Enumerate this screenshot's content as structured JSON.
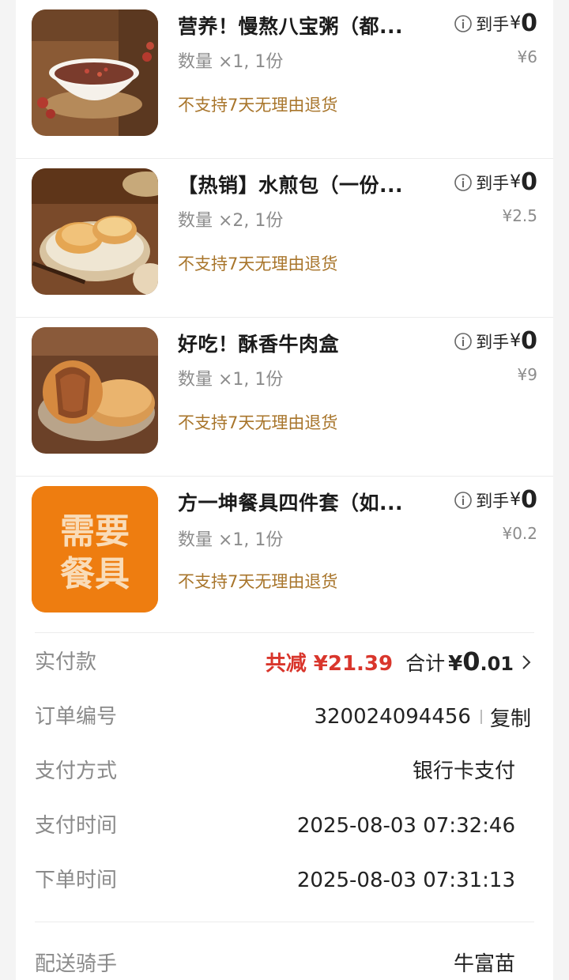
{
  "items": [
    {
      "name": "营养！慢熬八宝粥（都...",
      "qty": "数量 ×1, 1份",
      "policy": "不支持7天无理由退货",
      "net_label": "到手",
      "net_yen": "¥",
      "net_value": "0",
      "original": "¥6",
      "image": "eight-treasure-porridge"
    },
    {
      "name": "【热销】水煎包（一份...",
      "qty": "数量 ×2, 1份",
      "policy": "不支持7天无理由退货",
      "net_label": "到手",
      "net_yen": "¥",
      "net_value": "0",
      "original": "¥2.5",
      "image": "pan-fried-buns"
    },
    {
      "name": "好吃！酥香牛肉盒",
      "qty": "数量 ×1, 1份",
      "policy": "不支持7天无理由退货",
      "net_label": "到手",
      "net_yen": "¥",
      "net_value": "0",
      "original": "¥9",
      "image": "beef-pastry"
    },
    {
      "name": "方一坤餐具四件套（如...",
      "qty": "数量 ×1, 1份",
      "policy": "不支持7天无理由退货",
      "net_label": "到手",
      "net_yen": "¥",
      "net_value": "0",
      "original": "¥0.2",
      "image": "tableware-tile",
      "tile_text": [
        "需要",
        "餐具"
      ],
      "tile_color": "#ee7d10"
    }
  ],
  "payment": {
    "label": "实付款",
    "discount": "共减 ¥21.39",
    "total_label": "合计",
    "total_yen": "¥",
    "total_int": "0",
    "total_dec": ".01"
  },
  "order": {
    "label": "订单编号",
    "number": "320024094456",
    "copy": "复制"
  },
  "pay_method": {
    "label": "支付方式",
    "value": "银行卡支付"
  },
  "pay_time": {
    "label": "支付时间",
    "value": "2025-08-03 07:32:46"
  },
  "order_time": {
    "label": "下单时间",
    "value": "2025-08-03 07:31:13"
  },
  "rider": {
    "label": "配送骑手",
    "value": "牛富苗"
  },
  "colors": {
    "discount_red": "#d9362c",
    "policy_brown": "#a8752b",
    "tile_orange": "#ee7d10"
  }
}
